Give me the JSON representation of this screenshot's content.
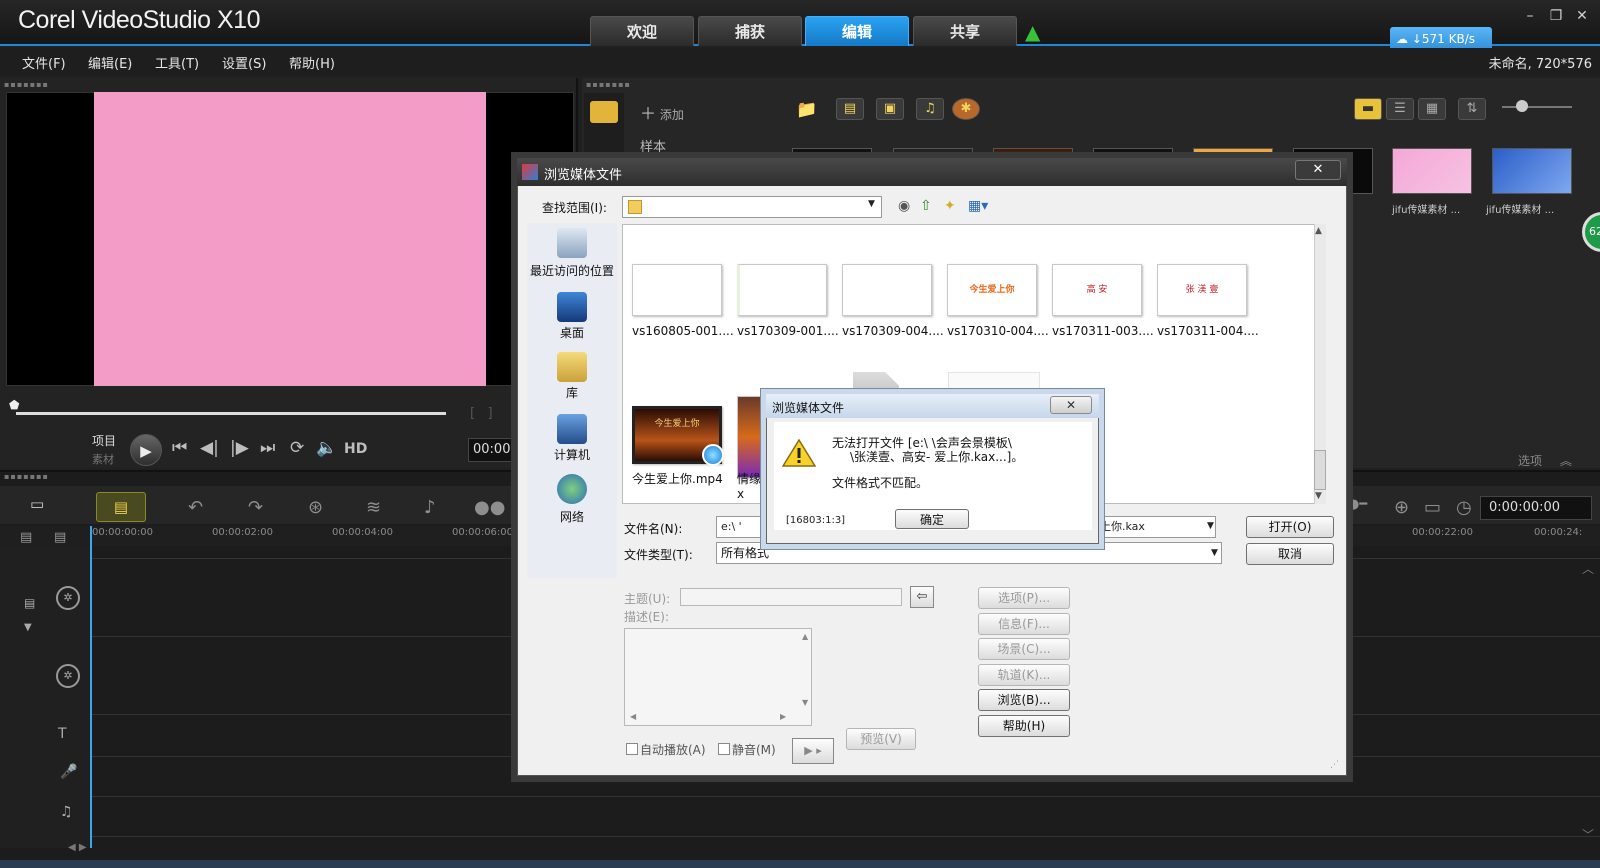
{
  "app": {
    "title": "Corel VideoStudio X10",
    "tabs": [
      "欢迎",
      "捕获",
      "编辑",
      "共享"
    ],
    "active_tab": "编辑",
    "speed": "↓571 KB/s",
    "window_buttons": [
      "–",
      "❐",
      "✕"
    ]
  },
  "menu": {
    "items": [
      "文件(F)",
      "编辑(E)",
      "工具(T)",
      "设置(S)",
      "帮助(H)"
    ],
    "project_info": "未命名, 720*576"
  },
  "preview": {
    "mode_project": "项目",
    "mode_clip": "素材",
    "hd_label": "HD",
    "timecode": "00:00"
  },
  "library": {
    "add_label": "添加",
    "sample_label": "样本",
    "thumb_captions": [
      "jifu传媒素材 ...",
      "jifu传媒素材 ..."
    ],
    "options_label": "选项",
    "badge": "62"
  },
  "timeline": {
    "ruler": [
      "00:00:00:00",
      "00:00:02:00",
      "00:00:04:00",
      "00:00:06:00",
      "00:00:22:00",
      "00:00:24:"
    ],
    "timecode": "0:00:00:00"
  },
  "browse_dialog": {
    "title": "浏览媒体文件",
    "look_in_label": "查找范围(I):",
    "places": [
      "最近访问的位置",
      "桌面",
      "库",
      "计算机",
      "网络"
    ],
    "files_row1": [
      {
        "name": "vs160805-001....",
        "text": ""
      },
      {
        "name": "vs170309-001....",
        "text": ""
      },
      {
        "name": "vs170309-004....",
        "text": ""
      },
      {
        "name": "vs170310-004....",
        "text": "今生爱上你"
      },
      {
        "name": "vs170311-003....",
        "text": "高 安"
      },
      {
        "name": "vs170311-004....",
        "text": "张 渼 壹"
      }
    ],
    "files_row2": [
      {
        "name": "今生爱上你.mp4",
        "text": "今生爱上你"
      },
      {
        "name": "情缘x",
        "text": ""
      }
    ],
    "filename_label": "文件名(N):",
    "filename_value": "e:\\ '",
    "filename_tail": "上你.kax",
    "filetype_label": "文件类型(T):",
    "filetype_value": "所有格式",
    "open_btn": "打开(O)",
    "cancel_btn": "取消",
    "subject_label": "主题(U):",
    "desc_label": "描述(E):",
    "autoplay_label": "自动播放(A)",
    "mute_label": "静音(M)",
    "preview_btn": "预览(V)",
    "side_buttons": [
      "选项(P)...",
      "信息(F)...",
      "场景(C)...",
      "轨道(K)...",
      "浏览(B)...",
      "帮助(H)"
    ]
  },
  "error_dialog": {
    "title": "浏览媒体文件",
    "line1": "无法打开文件 [e:\\        \\会声会景模板\\",
    "line2": "\\张渼壹、高安-      爱上你.kax...]。",
    "line3": "文件格式不匹配。",
    "code": "[16803:1:3]",
    "ok": "确定"
  }
}
